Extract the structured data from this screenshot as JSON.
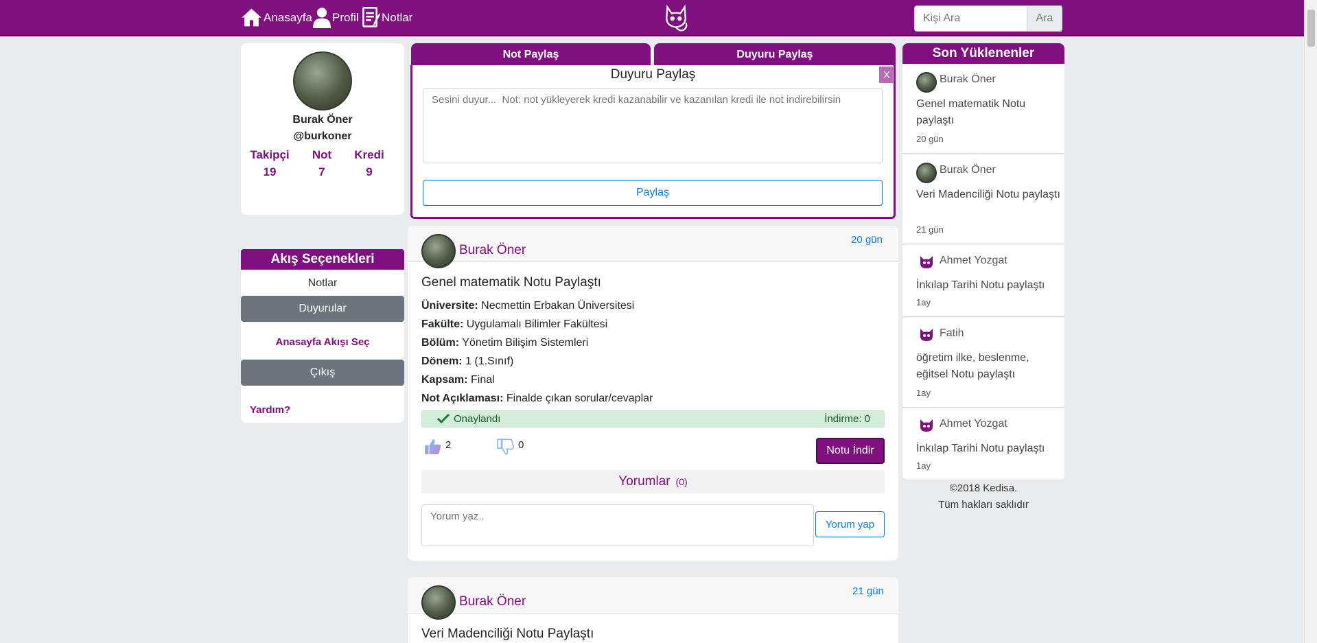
{
  "nav": {
    "home_label": "Anasayfa",
    "profile_label": "Profil",
    "notes_label": "Notlar",
    "search_placeholder": "Kişi Ara",
    "search_button": "Ara",
    "brand_color": "#800f80"
  },
  "profile": {
    "name": "Burak Öner",
    "handle": "@burkoner",
    "stats": [
      {
        "label": "Takipçi",
        "value": "19"
      },
      {
        "label": "Not",
        "value": "7"
      },
      {
        "label": "Kredi",
        "value": "9"
      }
    ]
  },
  "flow": {
    "title": "Akış Seçenekleri",
    "items": [
      "Notlar",
      "Duyurular"
    ],
    "home_flow": "Anasayfa Akışı Seç",
    "logout": "Çıkış",
    "help": "Yardım?"
  },
  "share": {
    "tabs": [
      "Not Paylaş",
      "Duyuru Paylaş"
    ],
    "title": "Duyuru Paylaş",
    "close": "X",
    "placeholder": "Sesini duyur...  Not: not yükleyerek kredi kazanabilir ve kazanılan kredi ile not indirebilirsin",
    "button": "Paylaş"
  },
  "posts": [
    {
      "author": "Burak Öner",
      "time": "20 gün",
      "title": "Genel matematik Notu Paylaştı",
      "fields": [
        {
          "label": "Üniversite:",
          "value": "Necmettin Erbakan Üniversitesi"
        },
        {
          "label": "Fakülte:",
          "value": "Uygulamalı Bilimler Fakültesi"
        },
        {
          "label": "Bölüm:",
          "value": "Yönetim Bilişim Sistemleri"
        },
        {
          "label": "Dönem:",
          "value": "1 (1.Sınıf)"
        },
        {
          "label": "Kapsam:",
          "value": "Final"
        },
        {
          "label": "Not Açıklaması:",
          "value": "Finalde çıkan sorular/cevaplar"
        }
      ],
      "status": "Onaylandı",
      "downloads": "İndirme: 0",
      "likes": "2",
      "dislikes": "0",
      "download_button": "Notu İndir",
      "comments_label": "Yorumlar",
      "comments_count": "(0)",
      "comment_placeholder": "Yorum yaz..",
      "comment_button": "Yorum yap"
    },
    {
      "author": "Burak Öner",
      "time": "21 gün",
      "title": "Veri Madenciliği Notu Paylaştı"
    }
  ],
  "recent": {
    "title": "Son Yüklenenler",
    "items": [
      {
        "name": "Burak Öner",
        "text": "Genel matematik Notu paylaştı",
        "time": "20 gün",
        "icon": "avatar"
      },
      {
        "name": "Burak Öner",
        "text": "Veri Madenciliği Notu paylaştı",
        "time": "21 gün",
        "icon": "avatar"
      },
      {
        "name": "Ahmet Yozgat",
        "text": "İnkılap Tarihi Notu paylaştı",
        "time": "1ay",
        "icon": "cat-icon"
      },
      {
        "name": "Fatih",
        "text": "öğretim ilke, beslenme, eğitsel Notu paylaştı",
        "time": "1ay",
        "icon": "cat-icon"
      },
      {
        "name": "Ahmet Yozgat",
        "text": "İnkılap Tarihi Notu paylaştı",
        "time": "1ay",
        "icon": "cat-icon"
      }
    ]
  },
  "footer": {
    "copyright": "©2018 Kedisa.",
    "rights": "Tüm hakları saklıdır"
  }
}
